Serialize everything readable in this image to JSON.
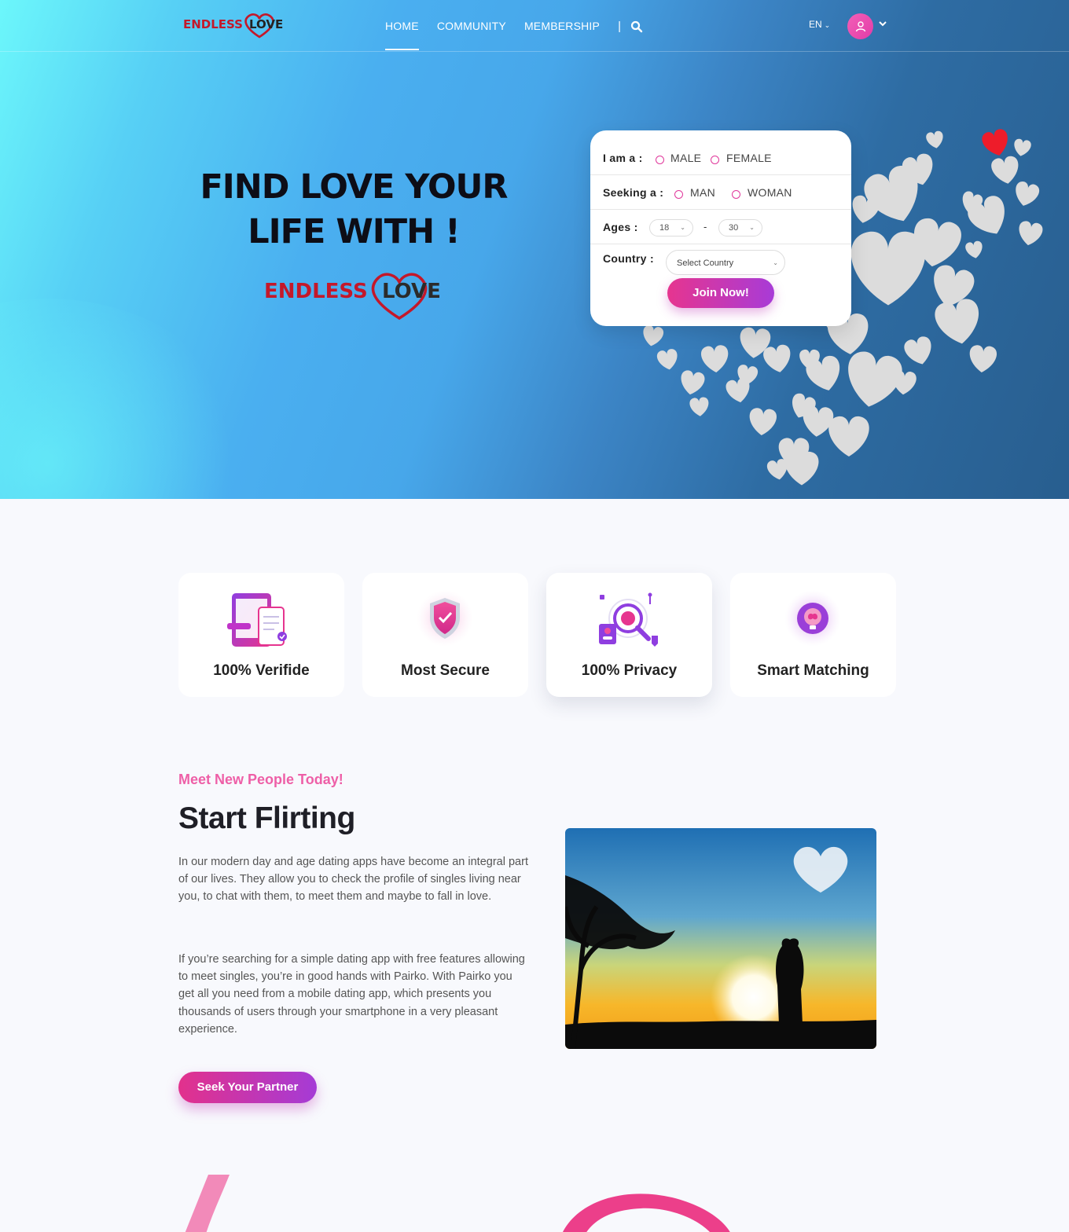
{
  "brand": {
    "logo_text_left": "ENDLESS",
    "logo_text_right": "LOVE"
  },
  "nav": {
    "items": [
      {
        "label": "HOME",
        "active": true
      },
      {
        "label": "COMMUNITY",
        "active": false
      },
      {
        "label": "MEMBERSHIP",
        "active": false
      }
    ],
    "separator": "|",
    "search_icon": "search-icon"
  },
  "header": {
    "language": "EN",
    "avatar_icon": "user-icon"
  },
  "hero": {
    "title_line1": "FIND LOVE YOUR",
    "title_line2": "LIFE WITH !"
  },
  "form": {
    "iam_label": "I am a :",
    "iam_options": [
      "MALE",
      "FEMALE"
    ],
    "seeking_label": "Seeking a :",
    "seeking_options": [
      "MAN",
      "WOMAN"
    ],
    "ages_label": "Ages :",
    "age_from": "18",
    "age_separator": "-",
    "age_to": "30",
    "country_label": "Country :",
    "country_placeholder": "Select Country",
    "join_label": "Join Now!"
  },
  "features": [
    {
      "title": "100% Verifide",
      "icon": "verified-devices-icon"
    },
    {
      "title": "Most Secure",
      "icon": "shield-check-icon"
    },
    {
      "title": "100% Privacy",
      "icon": "privacy-search-icon"
    },
    {
      "title": "Smart Matching",
      "icon": "brain-bulb-icon"
    }
  ],
  "flirting": {
    "subheading": "Meet New People Today!",
    "heading": "Start Flirting",
    "para1": "In our modern day and age dating apps have become an integral part of our lives. They allow you to check the profile of singles living near you, to chat with them, to meet them and maybe to fall in love.",
    "para2": "If you’re searching for a simple dating app with free features allowing to meet singles, you’re in good hands with Pairko. With Pairko you get all you need from a mobile dating app, which presents you thousands of users through your smartphone in a very pleasant experience.",
    "button": "Seek Your Partner"
  },
  "colors": {
    "accent_pink": "#e6358f",
    "accent_purple": "#a83bd7",
    "heading_pink": "#ee5fa7"
  }
}
